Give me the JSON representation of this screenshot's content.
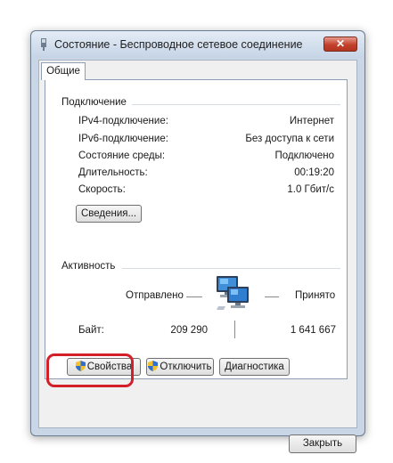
{
  "window": {
    "title": "Состояние - Беспроводное сетевое соединение",
    "close_symbol": "✕"
  },
  "tabs": [
    {
      "label": "Общие",
      "selected": true
    }
  ],
  "connection": {
    "group_title": "Подключение",
    "rows": [
      {
        "label": "IPv4-подключение:",
        "value": "Интернет"
      },
      {
        "label": "IPv6-подключение:",
        "value": "Без доступа к сети"
      },
      {
        "label": "Состояние среды:",
        "value": "Подключено"
      },
      {
        "label": "Длительность:",
        "value": "00:19:20"
      },
      {
        "label": "Скорость:",
        "value": "1.0 Гбит/с"
      }
    ],
    "details_button": "Сведения..."
  },
  "activity": {
    "group_title": "Активность",
    "sent_label": "Отправлено",
    "received_label": "Принято",
    "bytes_label": "Байт:",
    "bytes_sent": "209 290",
    "bytes_received": "1 641 667",
    "network_icon": "network-computers-icon"
  },
  "actions": {
    "properties": "Свойства",
    "disable": "Отключить",
    "diagnose": "Диагностика",
    "shield_icon": "uac-shield-icon",
    "highlight_color": "#d31f27"
  },
  "footer": {
    "close_button": "Закрыть"
  }
}
